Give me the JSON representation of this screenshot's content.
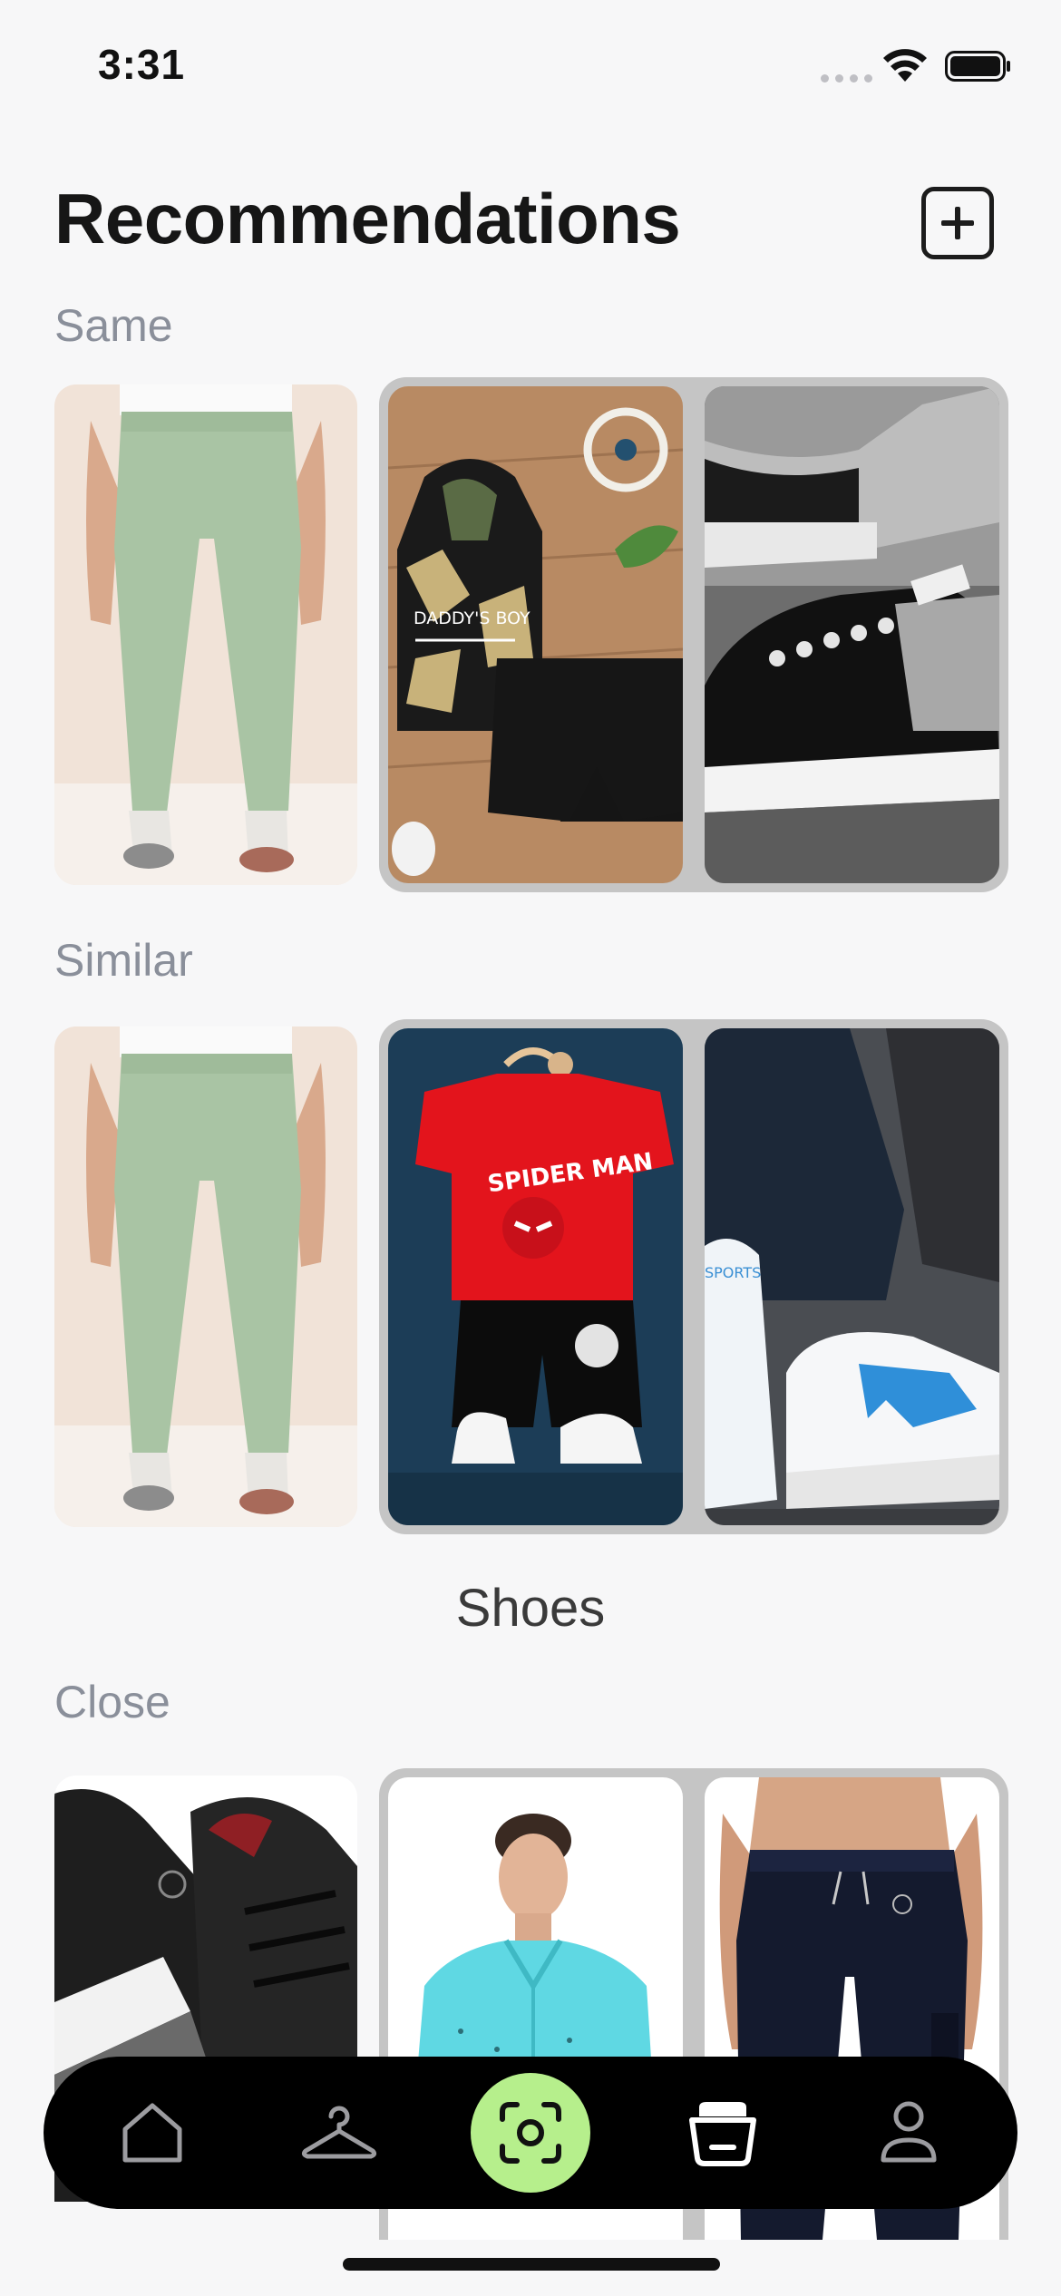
{
  "status_bar": {
    "time": "3:31"
  },
  "header": {
    "title": "Recommendations"
  },
  "sections": {
    "same": {
      "label": "Same"
    },
    "similar": {
      "label": "Similar"
    },
    "category": {
      "label": "Shoes"
    },
    "close": {
      "label": "Close"
    }
  },
  "product_texts": {
    "daddys_boy": "DADDY'S BOY",
    "spider_man": "SPIDER MAN",
    "sports": "SPORTS"
  },
  "bottom_nav": {
    "items": [
      {
        "icon": "home-icon"
      },
      {
        "icon": "hanger-icon"
      },
      {
        "icon": "scan-icon",
        "active": true
      },
      {
        "icon": "basket-icon"
      },
      {
        "icon": "profile-icon"
      }
    ]
  },
  "colors": {
    "accent": "#b6ef8c",
    "label_gray": "#8a8f9a",
    "group_border": "#c5c5c5",
    "nav_background": "#000000"
  }
}
